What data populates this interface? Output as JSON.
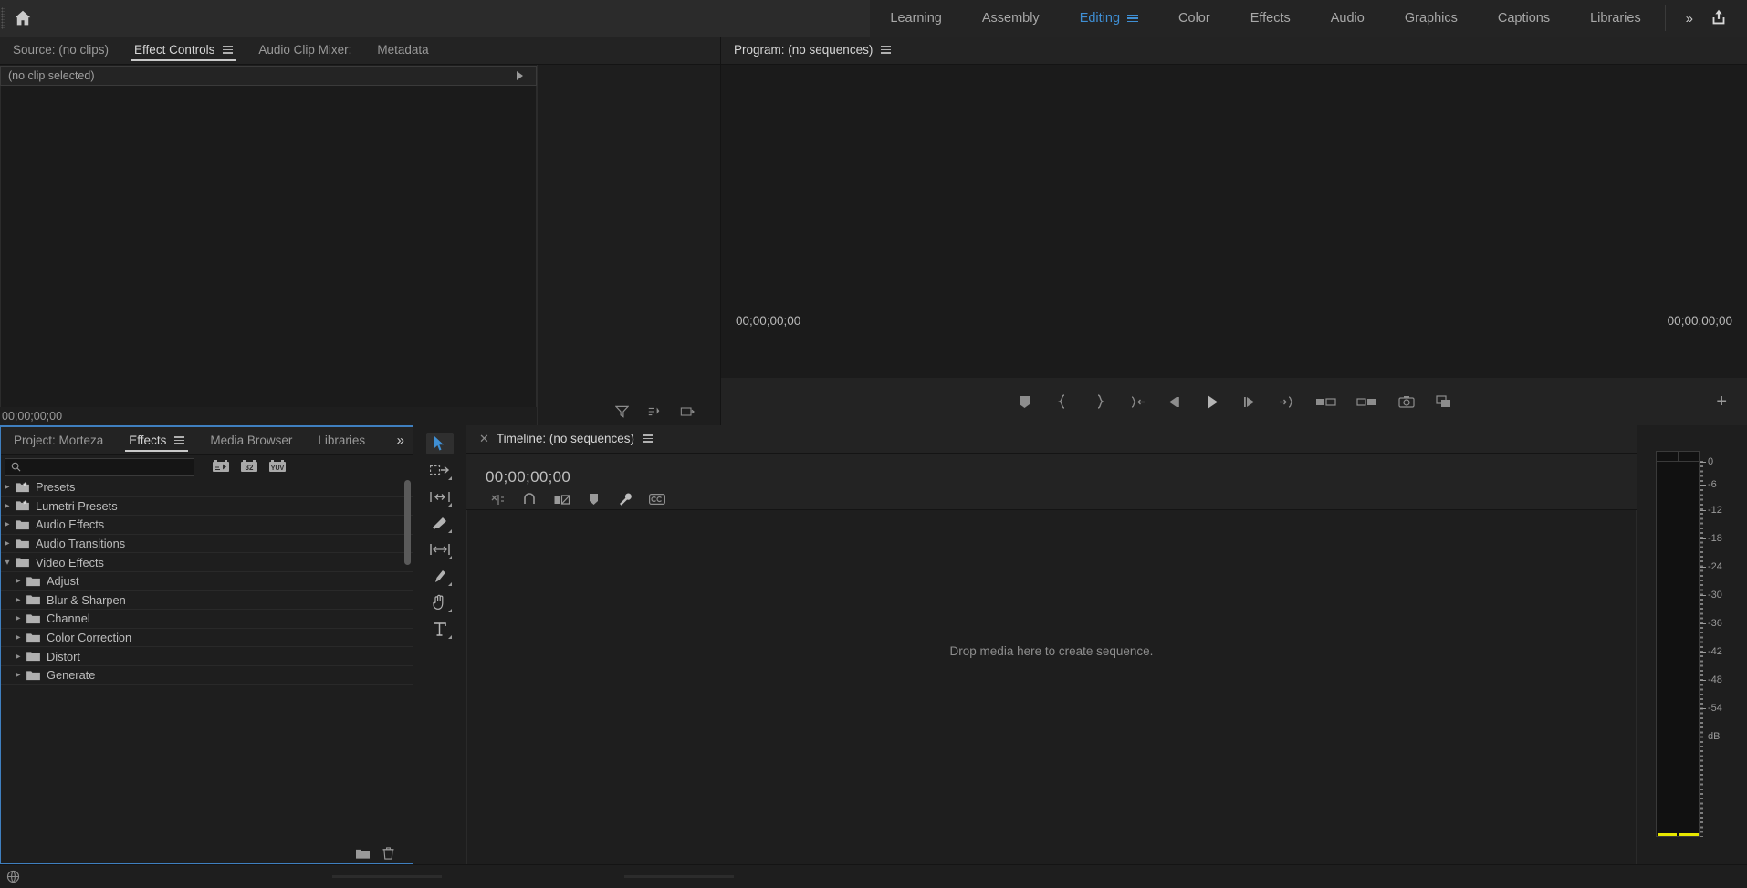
{
  "topbar": {
    "home_icon": "home-icon",
    "workspaces": [
      {
        "label": "Learning",
        "active": false
      },
      {
        "label": "Assembly",
        "active": false
      },
      {
        "label": "Editing",
        "active": true
      },
      {
        "label": "Color",
        "active": false
      },
      {
        "label": "Effects",
        "active": false
      },
      {
        "label": "Audio",
        "active": false
      },
      {
        "label": "Graphics",
        "active": false
      },
      {
        "label": "Captions",
        "active": false
      },
      {
        "label": "Libraries",
        "active": false
      }
    ],
    "overflow_label": "»",
    "export_icon": "export-share-icon",
    "accent_color": "#3f8fd4"
  },
  "effect_controls": {
    "tabs": [
      {
        "label": "Source: (no clips)",
        "active": false,
        "menu": false
      },
      {
        "label": "Effect Controls",
        "active": true,
        "menu": true
      },
      {
        "label": "Audio Clip Mixer:",
        "active": false,
        "menu": false
      },
      {
        "label": "Metadata",
        "active": false,
        "menu": false
      }
    ],
    "no_clip_label": "(no clip selected)",
    "timecode": "00;00;00;00",
    "icons": [
      "filter-icon",
      "keyframe-nav-icon",
      "export-frame-icon"
    ]
  },
  "program_monitor": {
    "tabs": [
      {
        "label": "Program: (no sequences)",
        "active": true,
        "menu": true
      }
    ],
    "current_time": "00;00;00;00",
    "duration": "00;00;00;00",
    "controls": [
      {
        "name": "add-marker-button"
      },
      {
        "name": "mark-in-button"
      },
      {
        "name": "mark-out-button"
      },
      {
        "name": "go-to-in-button"
      },
      {
        "name": "step-back-button"
      },
      {
        "name": "play-stop-button"
      },
      {
        "name": "step-forward-button"
      },
      {
        "name": "go-to-out-button"
      },
      {
        "name": "lift-button"
      },
      {
        "name": "extract-button"
      },
      {
        "name": "export-frame-button"
      },
      {
        "name": "comparison-view-button"
      }
    ],
    "button_plus": "+"
  },
  "effects_panel": {
    "tabs": [
      {
        "label": "Project: Morteza",
        "active": false,
        "menu": false
      },
      {
        "label": "Effects",
        "active": true,
        "menu": true
      },
      {
        "label": "Media Browser",
        "active": false,
        "menu": false
      },
      {
        "label": "Libraries",
        "active": false,
        "menu": false
      }
    ],
    "overflow_label": "»",
    "search_placeholder": "",
    "search_value": "",
    "filters": [
      {
        "name": "accelerated-effects-filter-icon",
        "label": "⇛"
      },
      {
        "name": "32bit-color-filter-icon",
        "label": "32"
      },
      {
        "name": "yuv-color-filter-icon",
        "label": "YUV"
      }
    ],
    "tree": [
      {
        "label": "Presets",
        "depth": 0,
        "expanded": false,
        "icon": "folder-star-icon"
      },
      {
        "label": "Lumetri Presets",
        "depth": 0,
        "expanded": false,
        "icon": "folder-star-icon"
      },
      {
        "label": "Audio Effects",
        "depth": 0,
        "expanded": false,
        "icon": "folder-icon"
      },
      {
        "label": "Audio Transitions",
        "depth": 0,
        "expanded": false,
        "icon": "folder-icon"
      },
      {
        "label": "Video Effects",
        "depth": 0,
        "expanded": true,
        "icon": "folder-icon"
      },
      {
        "label": "Adjust",
        "depth": 1,
        "expanded": false,
        "icon": "folder-icon"
      },
      {
        "label": "Blur & Sharpen",
        "depth": 1,
        "expanded": false,
        "icon": "folder-icon"
      },
      {
        "label": "Channel",
        "depth": 1,
        "expanded": false,
        "icon": "folder-icon"
      },
      {
        "label": "Color Correction",
        "depth": 1,
        "expanded": false,
        "icon": "folder-icon"
      },
      {
        "label": "Distort",
        "depth": 1,
        "expanded": false,
        "icon": "folder-icon"
      },
      {
        "label": "Generate",
        "depth": 1,
        "expanded": false,
        "icon": "folder-icon"
      }
    ],
    "footer_icons": [
      "new-custom-bin-icon",
      "delete-custom-item-icon"
    ]
  },
  "tools": [
    {
      "name": "selection-tool",
      "active": true
    },
    {
      "name": "track-select-forward-tool",
      "active": false
    },
    {
      "name": "ripple-edit-tool",
      "active": false
    },
    {
      "name": "razor-tool",
      "active": false
    },
    {
      "name": "slip-tool",
      "active": false
    },
    {
      "name": "pen-tool",
      "active": false
    },
    {
      "name": "hand-tool",
      "active": false
    },
    {
      "name": "type-tool",
      "active": false
    }
  ],
  "timeline": {
    "tabs": [
      {
        "label": "Timeline: (no sequences)",
        "active": true,
        "menu": true,
        "close": true
      }
    ],
    "playhead_timecode": "00;00;00;00",
    "toolbar_icons": [
      "snap-markers-icon",
      "snap-in-timeline-icon",
      "linked-selection-icon",
      "add-marker-icon",
      "timeline-settings-icon",
      "captions-icon"
    ],
    "empty_message": "Drop media here to create sequence."
  },
  "audio_meters": {
    "scale_labels": [
      "0",
      "-6",
      "-12",
      "-18",
      "-24",
      "-30",
      "-36",
      "-42",
      "-48",
      "-54",
      "dB"
    ],
    "channels": 2,
    "clip_indicator_color": "#e8e800"
  },
  "status_bar": {
    "icon": "media-browser-status-icon"
  }
}
